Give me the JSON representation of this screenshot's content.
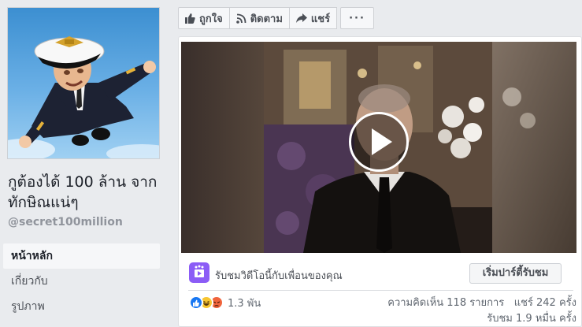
{
  "sidebar": {
    "page_name": "กูต้องได้ 100 ล้าน จากทักษิณแน่ๆ",
    "username": "@secret100million",
    "nav": [
      {
        "label": "หน้าหลัก",
        "active": true
      },
      {
        "label": "เกี่ยวกับ",
        "active": false
      },
      {
        "label": "รูปภาพ",
        "active": false
      }
    ]
  },
  "actions": {
    "like": "ถูกใจ",
    "follow": "ติดตาม",
    "share": "แชร์",
    "more": "···"
  },
  "post": {
    "watch_party_text": "รับชมวิดีโอนี้กับเพื่อนของคุณ",
    "watch_party_button": "เริ่มปาร์ตี้รับชม",
    "reaction_count": "1.3 พัน",
    "comments": "ความคิดเห็น 118 รายการ",
    "shares": "แชร์ 242 ครั้ง",
    "views": "รับชม 1.9 หมื่น ครั้ง"
  },
  "colors": {
    "like_blue": "#1877f2",
    "angry_orange": "#f0643c",
    "haha_yellow": "#f7c531",
    "party_purple": "#8b5cf6"
  },
  "icons": [
    "thumbs-up-icon",
    "rss-icon",
    "share-arrow-icon",
    "play-icon",
    "watch-party-icon"
  ]
}
